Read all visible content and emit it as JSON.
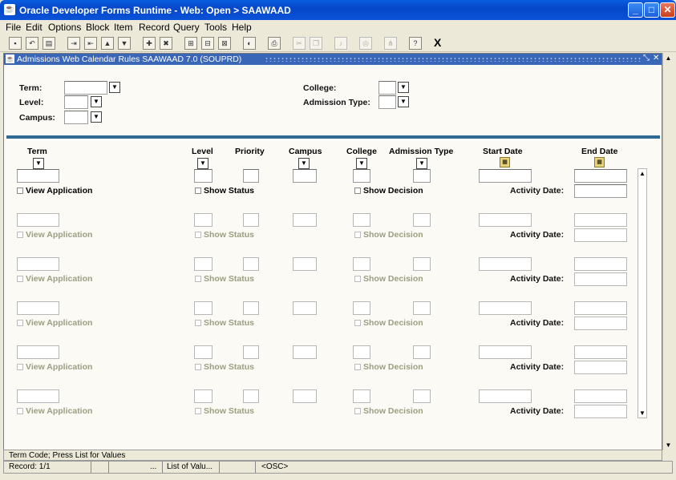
{
  "window": {
    "title": "Oracle Developer Forms Runtime - Web:  Open > SAAWAAD",
    "icon": "java-icon"
  },
  "menu": [
    "File",
    "Edit",
    "Options",
    "Block",
    "Item",
    "Record",
    "Query",
    "Tools",
    "Help"
  ],
  "toolbar": {
    "exit_label": "X"
  },
  "form": {
    "title": "Admissions Web Calendar Rules  SAAWAAD  7.0  (SOUPRD)"
  },
  "key": {
    "term_label": "Term:",
    "level_label": "Level:",
    "campus_label": "Campus:",
    "college_label": "College:",
    "admission_type_label": "Admission Type:"
  },
  "columns": {
    "term": "Term",
    "level": "Level",
    "priority": "Priority",
    "campus": "Campus",
    "college": "College",
    "admission_type": "Admission Type",
    "start_date": "Start Date",
    "end_date": "End Date"
  },
  "row_labels": {
    "view_application": "View Application",
    "show_status": "Show Status",
    "show_decision": "Show Decision",
    "activity_date": "Activity Date:"
  },
  "status": {
    "hint": "Term Code; Press List for Values",
    "record": "Record: 1/1",
    "ellipsis": "...",
    "list_of_values": "List of Valu...",
    "osc": "<OSC>"
  }
}
